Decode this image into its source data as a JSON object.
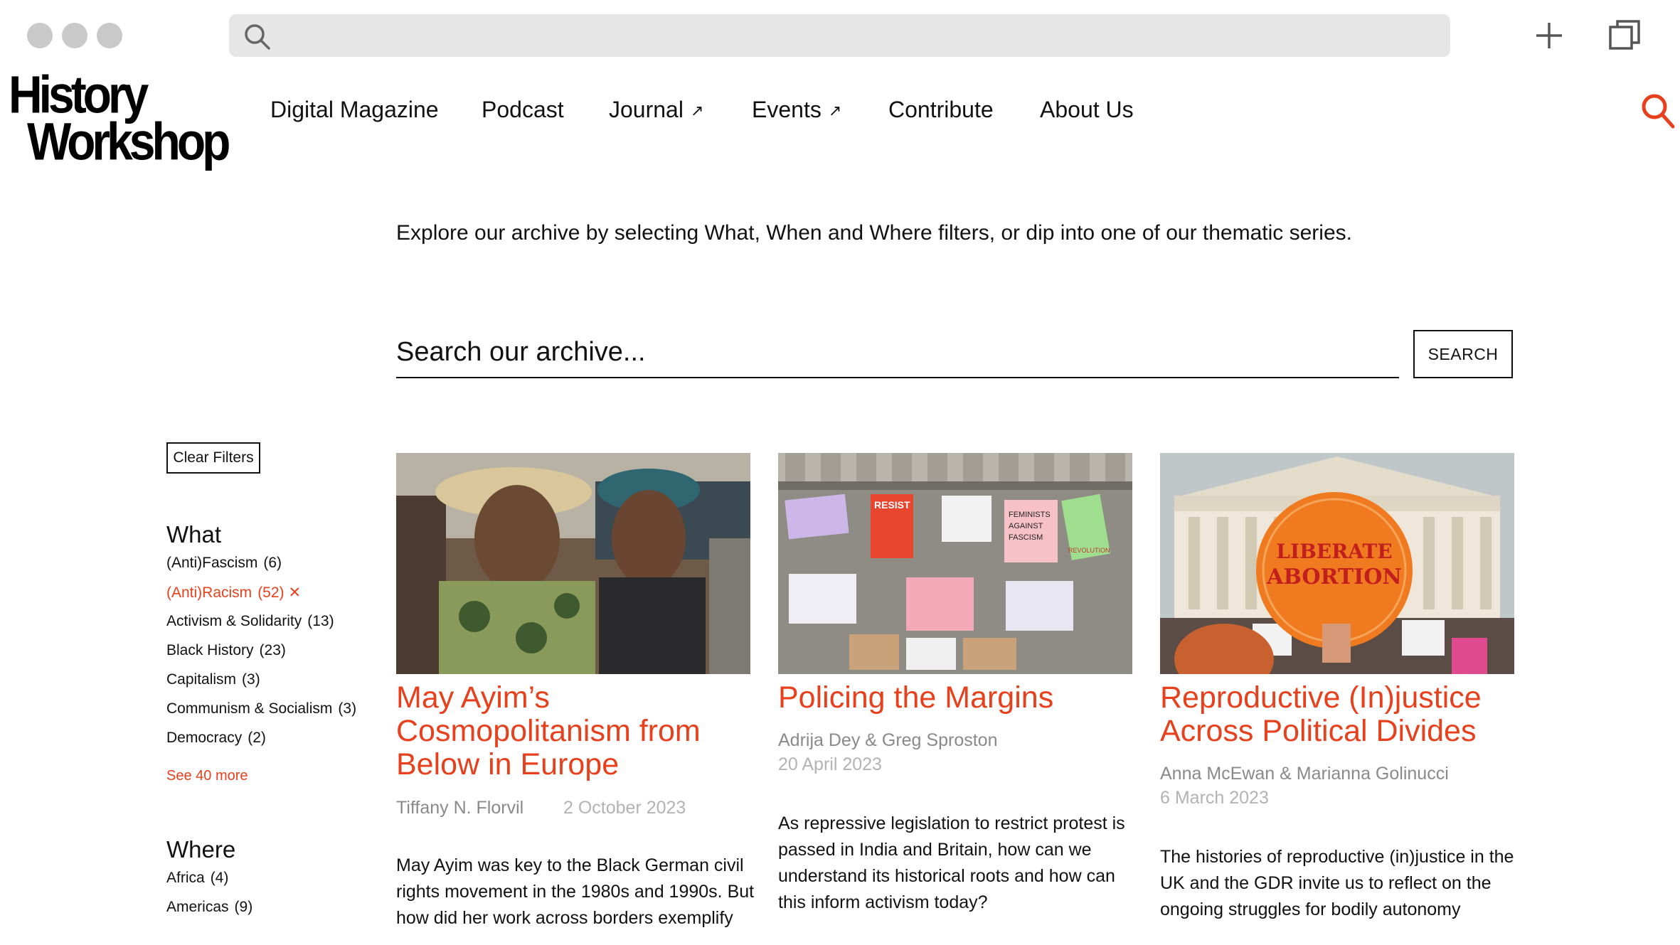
{
  "window": {
    "new_tab_icon": "plus-icon",
    "tabs_icon": "window-stack-icon",
    "url_search_icon": "search-icon"
  },
  "brand": {
    "logo_line1": "History",
    "logo_line2": "Workshop",
    "accent_color": "#e8401c"
  },
  "nav": {
    "items": [
      {
        "label": "Digital Magazine"
      },
      {
        "label": "Podcast"
      },
      {
        "label": "Journal",
        "external": true
      },
      {
        "label": "Events",
        "external": true
      },
      {
        "label": "Contribute"
      },
      {
        "label": "About Us"
      }
    ],
    "external_arrow": "↗"
  },
  "intro": "Explore our archive by selecting What, When and Where filters, or dip into one of our thematic series.",
  "archive_search": {
    "placeholder": "Search our archive...",
    "button_label": "SEARCH"
  },
  "sidebar": {
    "clear_label": "Clear Filters",
    "what_heading": "What",
    "what_filters": [
      {
        "label": "(Anti)Fascism",
        "count": "(6)"
      },
      {
        "label": "(Anti)Racism",
        "count": "(52)",
        "active": true,
        "remove": "✕"
      },
      {
        "label": "Activism & Solidarity",
        "count": "(13)"
      },
      {
        "label": "Black History",
        "count": "(23)"
      },
      {
        "label": "Capitalism",
        "count": "(3)"
      },
      {
        "label": "Communism & Socialism",
        "count": "(3)"
      },
      {
        "label": "Democracy",
        "count": "(2)"
      }
    ],
    "see_more": "See 40 more",
    "where_heading": "Where",
    "where_filters": [
      {
        "label": "Africa",
        "count": "(4)"
      },
      {
        "label": "Americas",
        "count": "(9)"
      }
    ]
  },
  "cards": [
    {
      "title_lines": [
        "May Ayim’s",
        "Cosmopolitanism from",
        "Below in Europe"
      ],
      "author": "Tiffany N. Florvil",
      "date": "2 October 2023",
      "excerpt_lines": [
        "May Ayim was key to the Black German civil",
        "rights movement in the 1980s and 1990s. But",
        "how did her work across borders exemplify"
      ]
    },
    {
      "title_lines": [
        "Policing the Margins"
      ],
      "author": "Adrija Dey & Greg Sproston",
      "date": "20 April 2023",
      "excerpt_lines": [
        "As repressive legislation to restrict protest is",
        "passed in India and Britain, how can we",
        "understand its historical roots and how can",
        "this inform activism today?"
      ],
      "poster_texts": [
        "RESIST",
        "FEMINISTS",
        "AGAINST",
        "FASCISM",
        "REVOLUTION"
      ]
    },
    {
      "title_lines": [
        "Reproductive (In)justice",
        "Across Political Divides"
      ],
      "author": "Anna McEwan & Marianna Golinucci",
      "date": "6 March 2023",
      "excerpt_lines": [
        "The histories of reproductive (in)justice in the",
        "UK and the GDR invite us to reflect on the",
        "ongoing struggles for bodily autonomy"
      ],
      "sign_line1": "LIBERATE",
      "sign_line2": "ABORTION"
    }
  ]
}
